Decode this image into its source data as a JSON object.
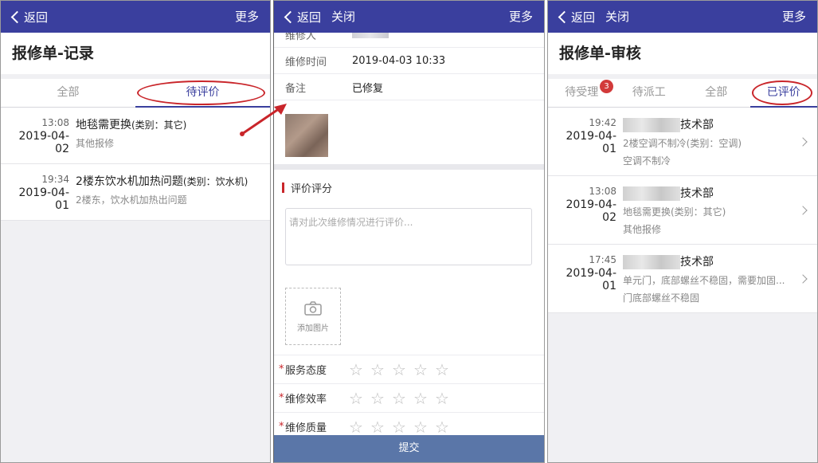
{
  "colors": {
    "navbar": "#3a3f9e",
    "highlight": "#c9252a",
    "submit": "#5a76a8"
  },
  "icons": {
    "back": "chevron-left-icon",
    "star": "star-outline-icon",
    "camera": "camera-icon",
    "row_arrow": "chevron-right-icon"
  },
  "panel1": {
    "nav": {
      "back": "返回",
      "more": "更多"
    },
    "title": "报修单-记录",
    "tabs": [
      "全部",
      "待评价"
    ],
    "active_tab": "待评价",
    "items": [
      {
        "time": "13:08",
        "date": "2019-04-02",
        "title": "地毯需更换",
        "category": "(类别：其它)",
        "desc": "其他报修"
      },
      {
        "time": "19:34",
        "date": "2019-04-01",
        "title": "2楼东饮水机加热问题",
        "category": "(类别：饮水机)",
        "desc": "2楼东，饮水机加热出问题"
      }
    ]
  },
  "panel2": {
    "nav": {
      "back": "返回",
      "close": "关闭",
      "more": "更多"
    },
    "rows": [
      {
        "label": "维修人",
        "value": ""
      },
      {
        "label": "维修时间",
        "value": "2019-04-03 10:33"
      },
      {
        "label": "备注",
        "value": "已修复"
      }
    ],
    "section_title": "评价评分",
    "textarea_placeholder": "请对此次维修情况进行评价...",
    "add_photo": "添加图片",
    "ratings": [
      {
        "label": "服务态度",
        "required": "*",
        "stars": 0
      },
      {
        "label": "维修效率",
        "required": "*",
        "stars": 0
      },
      {
        "label": "维修质量",
        "required": "*",
        "stars": 0
      }
    ],
    "submit": "提交"
  },
  "panel3": {
    "nav": {
      "back": "返回",
      "close": "关闭",
      "more": "更多"
    },
    "title": "报修单-审核",
    "tabs": [
      "待受理",
      "待派工",
      "全部",
      "已评价"
    ],
    "badge": "3",
    "active_tab": "已评价",
    "items": [
      {
        "time": "19:42",
        "date": "2019-04-01",
        "dept": "技术部",
        "title": "2楼空调不制冷(类别：空调)",
        "desc": "空调不制冷"
      },
      {
        "time": "13:08",
        "date": "2019-04-02",
        "dept": "技术部",
        "title": "地毯需更换(类别：其它)",
        "desc": "其他报修"
      },
      {
        "time": "17:45",
        "date": "2019-04-01",
        "dept": "技术部",
        "title": "单元门，底部螺丝不稳固，需要加固...",
        "desc": "门底部螺丝不稳固"
      }
    ]
  }
}
